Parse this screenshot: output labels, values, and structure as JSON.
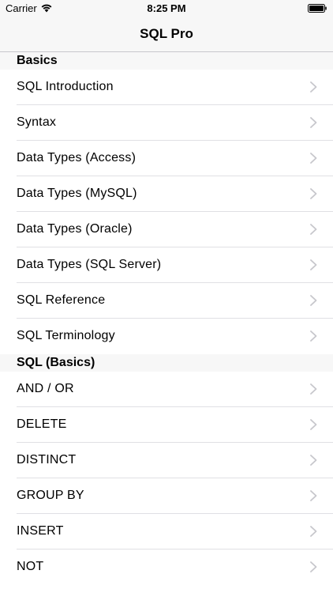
{
  "status_bar": {
    "carrier": "Carrier",
    "time": "8:25 PM"
  },
  "nav": {
    "title": "SQL Pro"
  },
  "sections": [
    {
      "header": "Basics",
      "items": [
        "SQL Introduction",
        "Syntax",
        "Data Types (Access)",
        "Data Types (MySQL)",
        "Data Types (Oracle)",
        "Data Types (SQL Server)",
        "SQL Reference",
        "SQL Terminology"
      ]
    },
    {
      "header": "SQL (Basics)",
      "items": [
        "AND / OR",
        "DELETE",
        "DISTINCT",
        "GROUP BY",
        "INSERT",
        "NOT"
      ]
    }
  ],
  "colors": {
    "bar_background": "#f7f7f7",
    "separator": "#e0e0e4",
    "chevron": "#c7c7cc"
  },
  "icons": {
    "row_accessory": "chevron-right-icon",
    "wifi": "wifi-icon",
    "battery": "battery-icon"
  }
}
